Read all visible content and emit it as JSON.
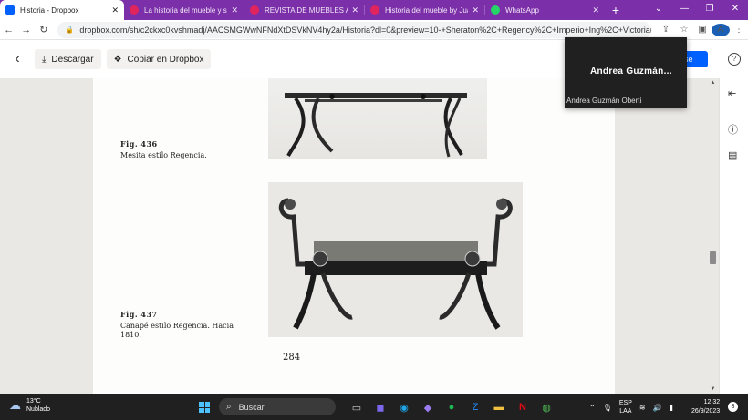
{
  "browser": {
    "tabs": [
      {
        "title": "Historia - Dropbox",
        "color": "#0061fe"
      },
      {
        "title": "La historia del mueble y su e",
        "color": "#e0245e"
      },
      {
        "title": "REVISTA DE MUEBLES ANTIGU",
        "color": "#e0245e"
      },
      {
        "title": "Historia del mueble by Juan",
        "color": "#e0245e"
      },
      {
        "title": "WhatsApp",
        "color": "#25d366"
      }
    ],
    "url": "dropbox.com/sh/c2ckxc0kvshmadj/AACSMGWwNFNdXtDSVkNV4hy2a/Historia?dl=0&preview=10-+Sheraton%2C+Regency%2C+Imperio+Ing%2C+Victoriano.pdf&su...",
    "avatar_letter": "A"
  },
  "toolbar": {
    "download_label": "Descargar",
    "copy_label": "Copiar en Dropbox",
    "signin_partial": "arse"
  },
  "tooltip": {
    "name": "Andrea  Guzmán...",
    "full_name": "Andrea Guzmán Oberti"
  },
  "document": {
    "fig436_label": "Fig. 436",
    "fig436_caption": "Mesita estilo Regencia.",
    "fig437_label": "Fig. 437",
    "fig437_caption_1": "Canapé estilo Regencia. Hacia",
    "fig437_caption_2": "1810.",
    "page_number": "284"
  },
  "taskbar": {
    "temperature": "13°C",
    "weather": "Nublado",
    "search_placeholder": "Buscar",
    "lang_1": "ESP",
    "lang_2": "LAA",
    "time": "12:32",
    "date": "26/9/2023",
    "notifications": "3"
  }
}
